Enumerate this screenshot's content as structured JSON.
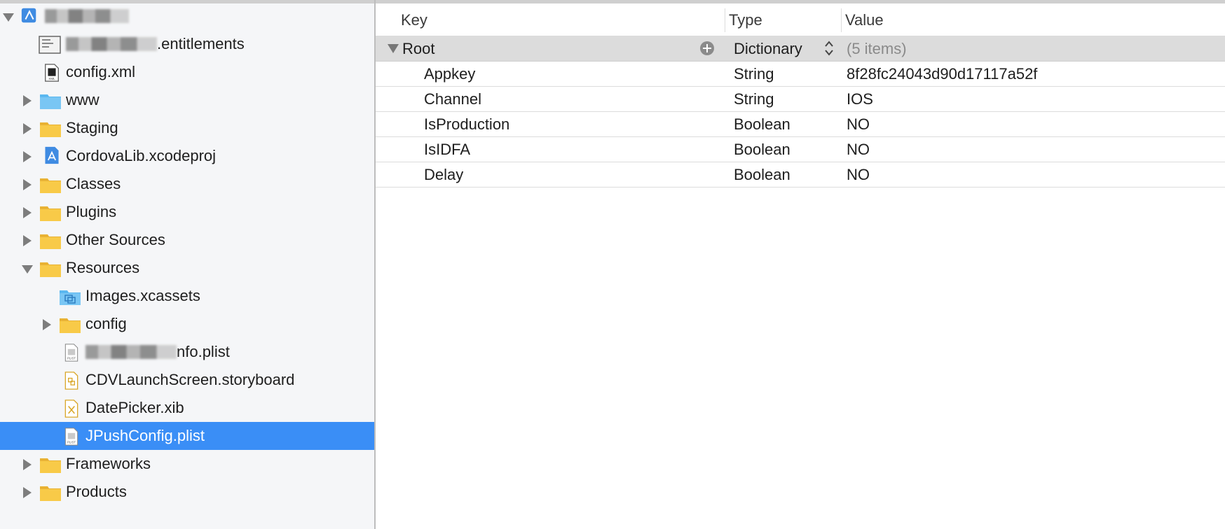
{
  "navigator": {
    "project": {
      "label_suffix": ""
    },
    "items": [
      {
        "id": "project",
        "label": "",
        "icon": "xcode-project-icon",
        "disclosure": "open",
        "blurred": true
      },
      {
        "id": "entitlements",
        "label": ".entitlements",
        "icon": "entitlements-file-icon",
        "blurred": true
      },
      {
        "id": "config-xml",
        "label": "config.xml",
        "icon": "xml-file-icon"
      },
      {
        "id": "www",
        "label": "www",
        "icon": "blue-folder-icon",
        "disclosure": "closed"
      },
      {
        "id": "staging",
        "label": "Staging",
        "icon": "folder-icon",
        "disclosure": "closed"
      },
      {
        "id": "cordovalib",
        "label": "CordovaLib.xcodeproj",
        "icon": "xcode-project-icon",
        "disclosure": "closed"
      },
      {
        "id": "classes",
        "label": "Classes",
        "icon": "folder-icon",
        "disclosure": "closed"
      },
      {
        "id": "plugins",
        "label": "Plugins",
        "icon": "folder-icon",
        "disclosure": "closed"
      },
      {
        "id": "other-sources",
        "label": "Other Sources",
        "icon": "folder-icon",
        "disclosure": "closed"
      },
      {
        "id": "resources",
        "label": "Resources",
        "icon": "folder-icon",
        "disclosure": "open"
      },
      {
        "id": "images-xcassets",
        "label": "Images.xcassets",
        "icon": "asset-catalog-icon"
      },
      {
        "id": "config-folder",
        "label": "config",
        "icon": "folder-icon",
        "disclosure": "closed"
      },
      {
        "id": "info-plist",
        "label": "nfo.plist",
        "icon": "plist-file-icon",
        "blurred": true
      },
      {
        "id": "cdvlaunchscreen",
        "label": "CDVLaunchScreen.storyboard",
        "icon": "storyboard-file-icon"
      },
      {
        "id": "datepicker",
        "label": "DatePicker.xib",
        "icon": "xib-file-icon"
      },
      {
        "id": "jpushconfig",
        "label": "JPushConfig.plist",
        "icon": "plist-file-icon",
        "selected": true
      },
      {
        "id": "frameworks",
        "label": "Frameworks",
        "icon": "folder-icon",
        "disclosure": "closed"
      },
      {
        "id": "products",
        "label": "Products",
        "icon": "folder-icon",
        "disclosure": "closed"
      }
    ]
  },
  "editor": {
    "headers": {
      "key": "Key",
      "type": "Type",
      "value": "Value"
    },
    "root": {
      "key": "Root",
      "type": "Dictionary",
      "value": "(5 items)"
    },
    "rows": [
      {
        "key": "Appkey",
        "type": "String",
        "value": "8f28fc24043d90d17117a52f"
      },
      {
        "key": "Channel",
        "type": "String",
        "value": "IOS"
      },
      {
        "key": "IsProduction",
        "type": "Boolean",
        "value": "NO"
      },
      {
        "key": "IsIDFA",
        "type": "Boolean",
        "value": "NO"
      },
      {
        "key": "Delay",
        "type": "Boolean",
        "value": "NO"
      }
    ]
  },
  "colors": {
    "selection": "#3a8ef6",
    "folder": "#f6c344",
    "blue_folder": "#5bb8f0"
  }
}
